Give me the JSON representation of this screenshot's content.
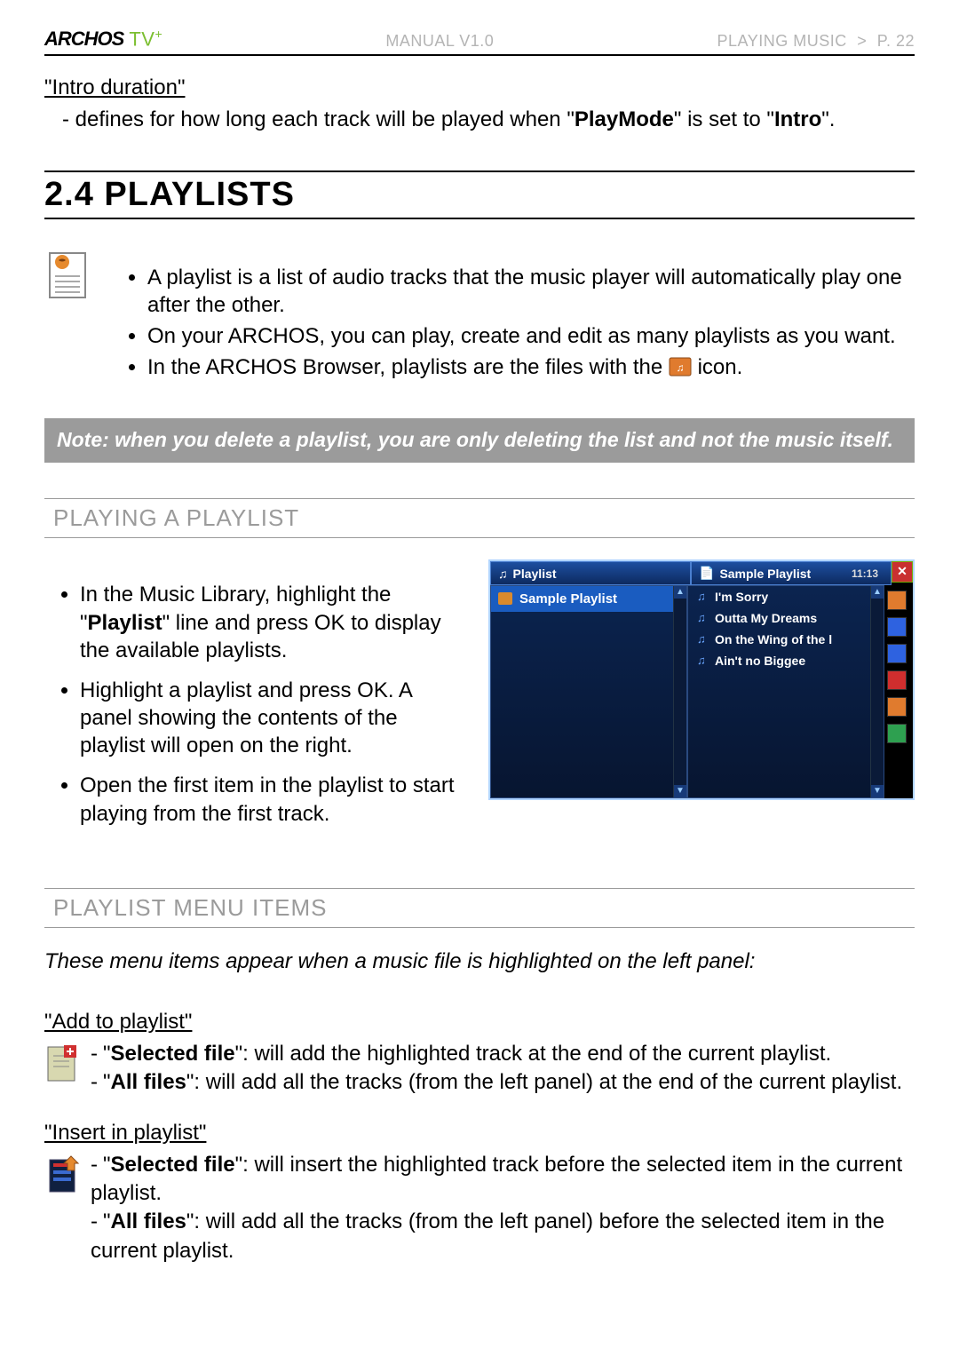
{
  "header": {
    "brand": "ARCHOS",
    "product": "TV",
    "product_plus": "+",
    "manual_label": "MANUAL",
    "manual_version": " V1.0",
    "breadcrumb_section": "PLAYING MUSIC",
    "breadcrumb_gt": ">",
    "breadcrumb_page": "P. 22"
  },
  "intro_duration": {
    "title": "\"Intro duration\"",
    "desc_prefix": "- defines for how long each track will be played when \"",
    "desc_bold1": "PlayMode",
    "desc_mid": "\" is set to \"",
    "desc_bold2": "Intro",
    "desc_suffix": "\"."
  },
  "section_24": {
    "title": "2.4  PLAYLISTS",
    "bullets": [
      "A playlist is a list of audio tracks that the music player will automatically play one after the other.",
      "On your ARCHOS, you can play, create and edit as many playlists as you want."
    ],
    "bullet3_prefix": "In the ARCHOS Browser, playlists are the files with the ",
    "bullet3_suffix": " icon.",
    "note": "Note: when you delete a playlist, you are only deleting the list and not the music itself."
  },
  "playing_playlist": {
    "heading": "PLAYING A PLAYLIST",
    "items_pre": [
      "In the Music Library, highlight the \"",
      "Highlight a playlist and press ",
      "Open the first item in the playlist to start playing from the first track."
    ],
    "item1_bold": "Playlist",
    "item1_mid": "\" line and press ",
    "item1_ok": "OK",
    "item1_post": " to display the available playlists.",
    "item2_ok": "OK",
    "item2_post": ". A panel showing the contents of the playlist will open on the right."
  },
  "screenshot": {
    "left_tab": "Playlist",
    "right_tab": "Sample Playlist",
    "time": "11:13",
    "left_item": "Sample Playlist",
    "tracks": [
      "I'm Sorry",
      "Outta My Dreams",
      "On the Wing of the l",
      "Ain't no Biggee"
    ]
  },
  "playlist_menu": {
    "heading": "PLAYLIST MENU ITEMS",
    "intro": "These menu items appear when a music file is highlighted on the left panel:",
    "add_title": "\"Add to playlist\"",
    "add_sel_label": "Selected file",
    "add_sel_text": "\": will add the highlighted track at the end of the current playlist.",
    "add_all_label": "All files",
    "add_all_text": "\": will add all the tracks (from the left panel) at the end of the current playlist.",
    "ins_title": "\"Insert in playlist\"",
    "ins_sel_label": "Selected file",
    "ins_sel_text": "\": will insert the highlighted track before the selected item in the current playlist.",
    "ins_all_label": "All files",
    "ins_all_text": "\": will add all the tracks (from the left panel) before the selected item in the current playlist."
  }
}
